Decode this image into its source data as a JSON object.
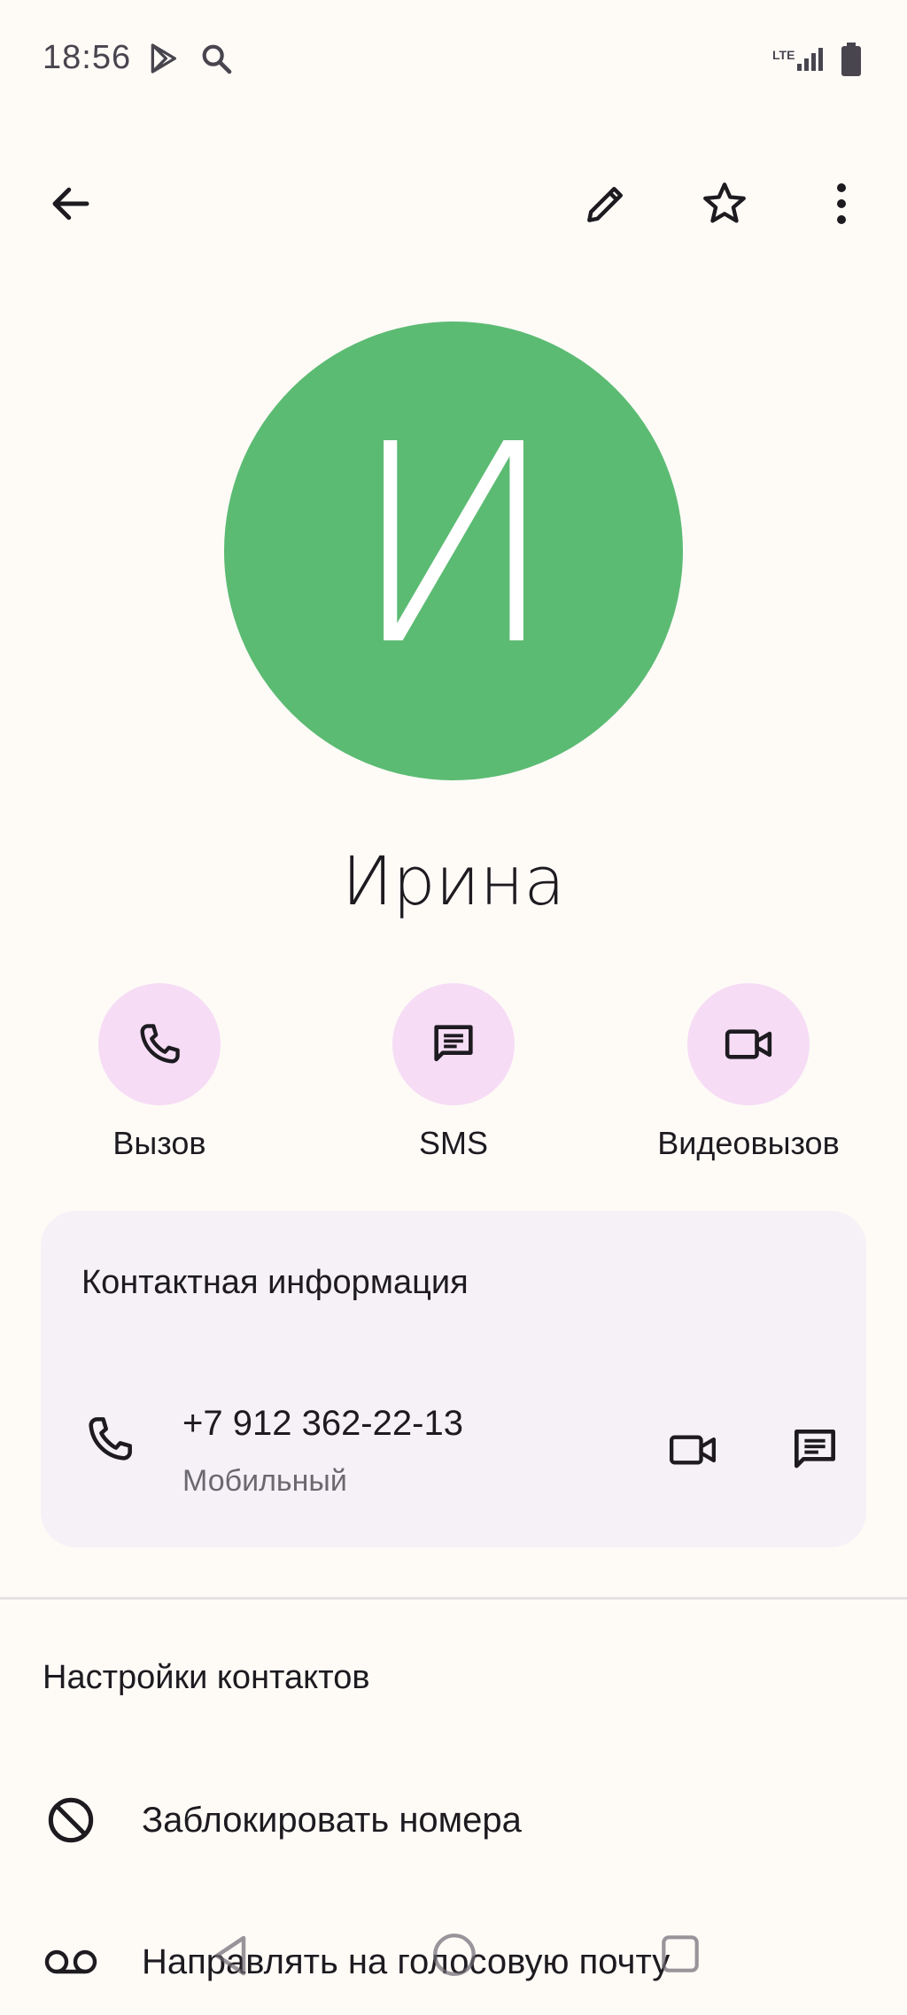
{
  "status_bar": {
    "time": "18:56",
    "icons": [
      "play-store-icon",
      "search-icon",
      "lte-icon",
      "signal-icon",
      "battery-icon"
    ],
    "network_label": "LTE"
  },
  "top_bar": {
    "icons": [
      "back-arrow-icon",
      "edit-pencil-icon",
      "star-icon",
      "more-vert-icon"
    ]
  },
  "contact": {
    "initial": "И",
    "name": "Ирина",
    "avatar_color": "#5CBB73"
  },
  "actions": [
    {
      "label": "Вызов",
      "icon": "phone-icon"
    },
    {
      "label": "SMS",
      "icon": "message-icon"
    },
    {
      "label": "Видеовызов",
      "icon": "videocam-icon"
    }
  ],
  "contact_info": {
    "title": "Контактная информация",
    "phone": "+7 912 362-22-13",
    "phone_type": "Мобильный"
  },
  "settings": {
    "title": "Настройки контактов",
    "items": [
      {
        "label": "Заблокировать номера",
        "icon": "block-icon"
      },
      {
        "label": "Направлять на голосовую почту",
        "icon": "voicemail-icon"
      }
    ]
  },
  "colors": {
    "background": "#FEFBF7",
    "action_circle": "#F6DCF5",
    "card": "#F5F1F7",
    "avatar": "#5CBB73"
  }
}
